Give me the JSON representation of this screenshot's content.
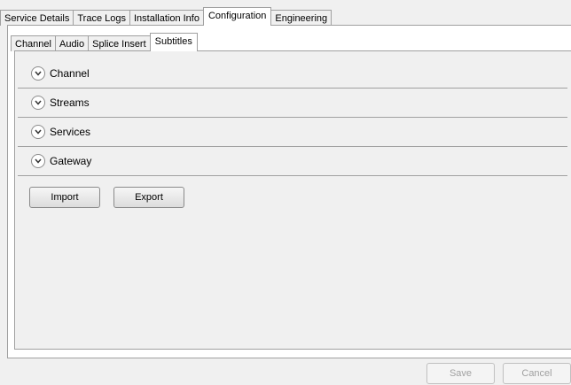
{
  "top_tabs": [
    {
      "label": "Service Details"
    },
    {
      "label": "Trace Logs"
    },
    {
      "label": "Installation Info"
    },
    {
      "label": "Configuration"
    },
    {
      "label": "Engineering"
    }
  ],
  "active_top_tab": "Configuration",
  "sub_tabs": [
    {
      "label": "Channel"
    },
    {
      "label": "Audio"
    },
    {
      "label": "Splice Insert"
    },
    {
      "label": "Subtitles"
    }
  ],
  "active_sub_tab": "Subtitles",
  "sections": [
    {
      "label": "Channel",
      "icon": "chevron-down-icon"
    },
    {
      "label": "Streams",
      "icon": "chevron-down-icon"
    },
    {
      "label": "Services",
      "icon": "chevron-down-icon"
    },
    {
      "label": "Gateway",
      "icon": "chevron-down-icon"
    }
  ],
  "buttons": {
    "import": "Import",
    "export": "Export",
    "save": "Save",
    "cancel": "Cancel"
  }
}
